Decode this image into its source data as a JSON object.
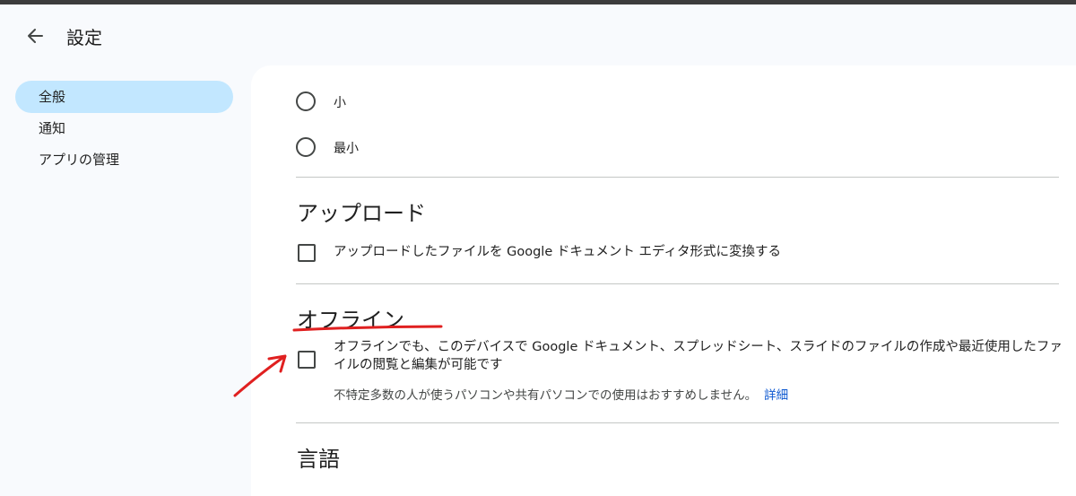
{
  "header": {
    "title": "設定",
    "back_icon": "arrow-back-icon"
  },
  "sidebar": {
    "items": [
      {
        "label": "全般",
        "active": true
      },
      {
        "label": "通知",
        "active": false
      },
      {
        "label": "アプリの管理",
        "active": false
      }
    ]
  },
  "density": {
    "options": [
      {
        "label": "小",
        "selected": false
      },
      {
        "label": "最小",
        "selected": false
      }
    ]
  },
  "upload": {
    "title": "アップロード",
    "convert_label": "アップロードしたファイルを Google ドキュメント エディタ形式に変換する",
    "checked": false
  },
  "offline": {
    "title": "オフライン",
    "label": "オフラインでも、このデバイスで Google ドキュメント、スプレッドシート、スライドのファイルの作成や最近使用したファイルの閲覧と編集が可能です",
    "hint": "不特定多数の人が使うパソコンや共有パソコンでの使用はおすすめしません。",
    "details_link": "詳細",
    "checked": false
  },
  "language": {
    "title": "言語"
  },
  "colors": {
    "accent": "#0b57d0",
    "nav_active": "#c2e7ff",
    "annotation": "#e02020"
  }
}
